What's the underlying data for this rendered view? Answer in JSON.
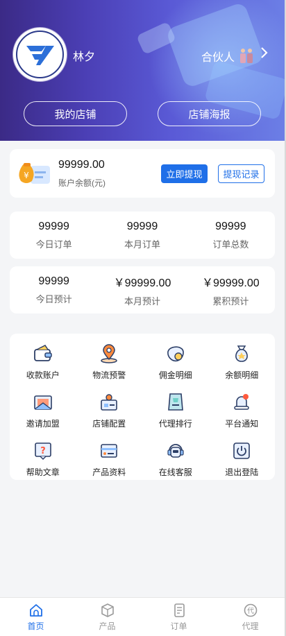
{
  "header": {
    "username": "林夕",
    "partner_label": "合伙人",
    "buttons": {
      "my_store": "我的店铺",
      "store_poster": "店铺海报"
    }
  },
  "balance": {
    "amount": "99999.00",
    "label": "账户余额(元)",
    "withdraw_label": "立即提现",
    "record_label": "提现记录"
  },
  "orders": [
    {
      "value": "99999",
      "label": "今日订单"
    },
    {
      "value": "99999",
      "label": "本月订单"
    },
    {
      "value": "99999",
      "label": "订单总数"
    }
  ],
  "estimates": [
    {
      "value": "99999",
      "label": "今日预计"
    },
    {
      "value": "￥99999.00",
      "label": "本月预计"
    },
    {
      "value": "￥99999.00",
      "label": "累积预计"
    }
  ],
  "menu": [
    {
      "label": "收款账户",
      "icon": "wallet-icon"
    },
    {
      "label": "物流预警",
      "icon": "location-pin-icon"
    },
    {
      "label": "佣金明细",
      "icon": "coins-icon"
    },
    {
      "label": "余额明细",
      "icon": "money-bag-icon"
    },
    {
      "label": "邀请加盟",
      "icon": "invite-envelope-icon"
    },
    {
      "label": "店铺配置",
      "icon": "store-config-icon"
    },
    {
      "label": "代理排行",
      "icon": "ranking-icon"
    },
    {
      "label": "平台通知",
      "icon": "bell-icon"
    },
    {
      "label": "帮助文章",
      "icon": "help-icon"
    },
    {
      "label": "产品资料",
      "icon": "product-card-icon"
    },
    {
      "label": "在线客服",
      "icon": "customer-service-icon"
    },
    {
      "label": "退出登陆",
      "icon": "power-icon"
    }
  ],
  "tabs": [
    {
      "label": "首页",
      "icon": "home-icon",
      "active": true
    },
    {
      "label": "产品",
      "icon": "box-icon",
      "active": false
    },
    {
      "label": "订单",
      "icon": "order-icon",
      "active": false
    },
    {
      "label": "代理",
      "icon": "agent-icon",
      "active": false
    }
  ],
  "colors": {
    "accent": "#1f6fe8",
    "header_start": "#3b2a86",
    "header_end": "#6c7fe6"
  }
}
